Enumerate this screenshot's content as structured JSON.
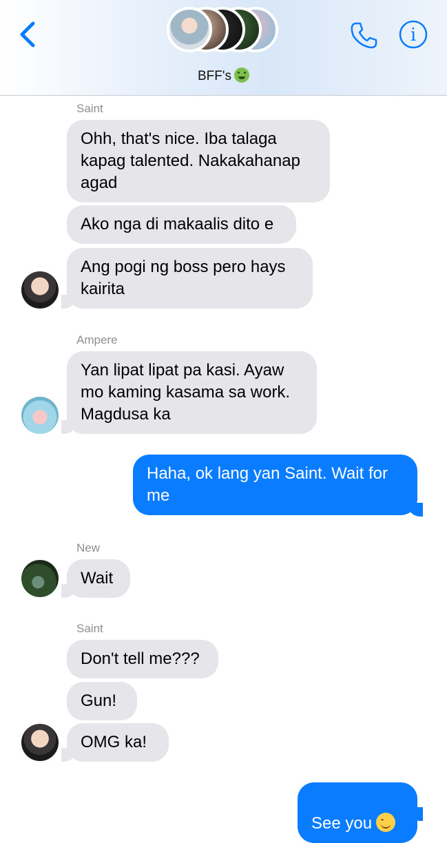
{
  "header": {
    "group_name": "BFF's",
    "title_emoji": "nauseated-face-emoji",
    "back_icon": "chevron-left-icon",
    "call_icon": "phone-icon",
    "info_icon": "info-icon",
    "accent_color": "#0a7cff"
  },
  "messages": [
    {
      "sender": "Saint",
      "side": "in",
      "text": "Ohh, that's nice. Iba talaga\nkapag talented. Nakakahanap\nagad"
    },
    {
      "side": "in",
      "text": "Ako nga di makaalis dito e"
    },
    {
      "side": "in",
      "text": "Ang pogi ng boss pero hays\nkairita"
    },
    {
      "sender": "Ampere",
      "side": "in",
      "text": "Yan lipat lipat pa kasi. Ayaw\nmo kaming kasama sa work.\nMagdusa ka"
    },
    {
      "side": "out",
      "text": "Haha, ok lang yan Saint. Wait for\nme"
    },
    {
      "sender": "New",
      "side": "in",
      "text": "Wait"
    },
    {
      "sender": "Saint",
      "side": "in",
      "text": "Don't tell me???"
    },
    {
      "side": "in",
      "text": "Gun!"
    },
    {
      "side": "in",
      "text": "OMG ka!"
    },
    {
      "side": "out",
      "text": "See you",
      "emoji": "smiling-face-emoji"
    }
  ],
  "colors": {
    "incoming_bubble": "#e5e5ea",
    "outgoing_bubble": "#0a7cff",
    "sender_label": "#8e8e93"
  }
}
